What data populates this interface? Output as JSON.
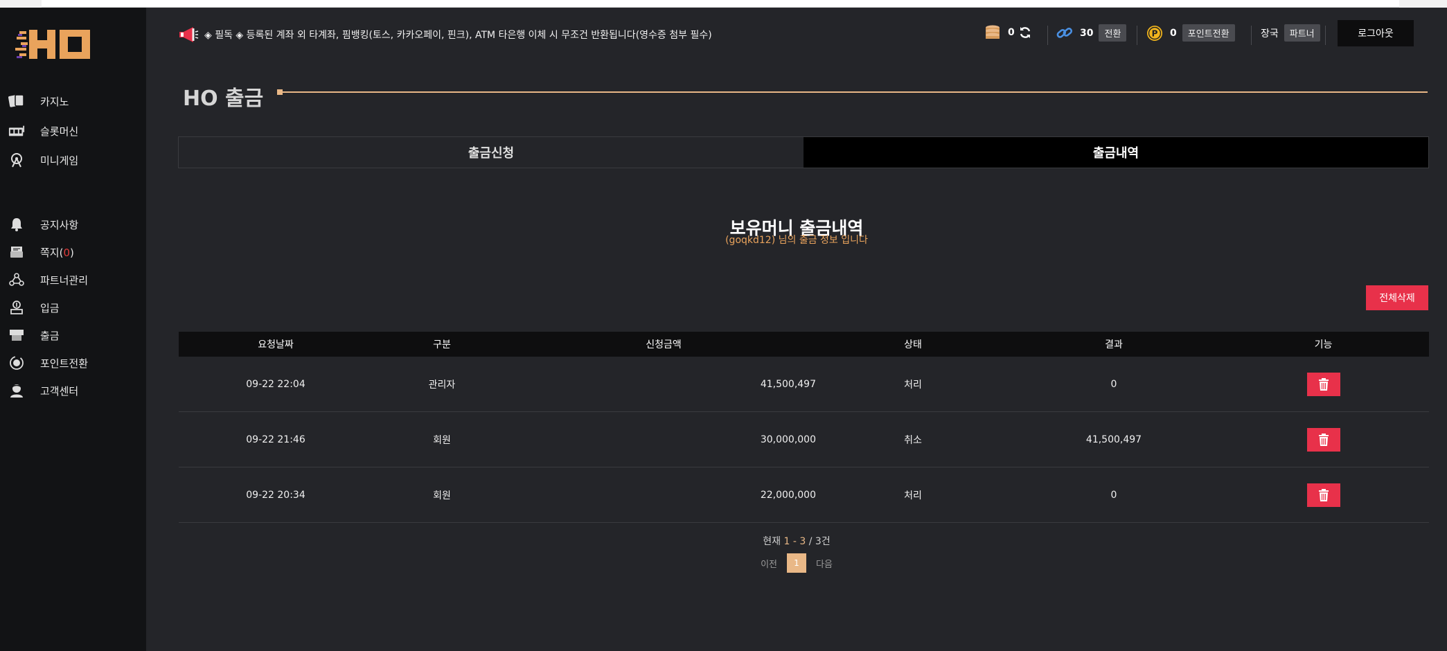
{
  "sidebar": {
    "logo_text": "HO",
    "group1": [
      {
        "label": "카지노",
        "icon": "cards-icon"
      },
      {
        "label": "슬롯머신",
        "icon": "slot-machine-icon"
      },
      {
        "label": "미니게임",
        "icon": "ferris-wheel-icon"
      }
    ],
    "group2": [
      {
        "label": "공지사항",
        "icon": "bell-icon"
      },
      {
        "label": "쪽지(",
        "badge": "0",
        "suffix": ")",
        "icon": "message-icon"
      },
      {
        "label": "파트너관리",
        "icon": "network-icon"
      },
      {
        "label": "입금",
        "icon": "deposit-icon"
      },
      {
        "label": "출금",
        "icon": "withdraw-icon"
      },
      {
        "label": "포인트전환",
        "icon": "point-convert-icon"
      },
      {
        "label": "고객센터",
        "icon": "support-icon"
      }
    ]
  },
  "header": {
    "notice": "◈ 필독 ◈ 등록된 계좌 외 타계좌, 핌뱅킹(토스, 카카오페이, 핀크), ATM 타은행 이체 시 무조건 반환됩니다(영수증 첨부 필수)",
    "money": "0",
    "rolling": "30",
    "rolling_btn": "전환",
    "point": "0",
    "point_btn": "포인트전환",
    "rank": "장국",
    "rank_btn": "파트너",
    "logout": "로그아웃"
  },
  "page": {
    "title": "HO 출금",
    "tabs": [
      {
        "label": "출금신청",
        "active": false
      },
      {
        "label": "출금내역",
        "active": true
      }
    ],
    "section_title": "보유머니 출금내역",
    "section_sub_user": "(goqkd12)",
    "section_sub_text": " 님의 출금 정보 입니다",
    "delete_all": "전체삭제"
  },
  "table": {
    "headers": [
      "요청날짜",
      "구분",
      "신청금액",
      "상태",
      "결과",
      "기능"
    ],
    "rows": [
      {
        "date": "09-22 22:04",
        "type": "관리자",
        "amount": "41,500,497",
        "status": "처리",
        "result": "0"
      },
      {
        "date": "09-22 21:46",
        "type": "회원",
        "amount": "30,000,000",
        "status": "취소",
        "result": "41,500,497"
      },
      {
        "date": "09-22 20:34",
        "type": "회원",
        "amount": "22,000,000",
        "status": "처리",
        "result": "0"
      }
    ]
  },
  "pagination": {
    "prefix": "현재 ",
    "range": "1 - 3",
    "suffix": " / 3건",
    "prev": "이전",
    "current": "1",
    "next": "다음"
  },
  "colors": {
    "accent": "#e9b887",
    "danger": "#e8314a",
    "sidebar_bg": "#121315",
    "main_bg": "#242529"
  }
}
